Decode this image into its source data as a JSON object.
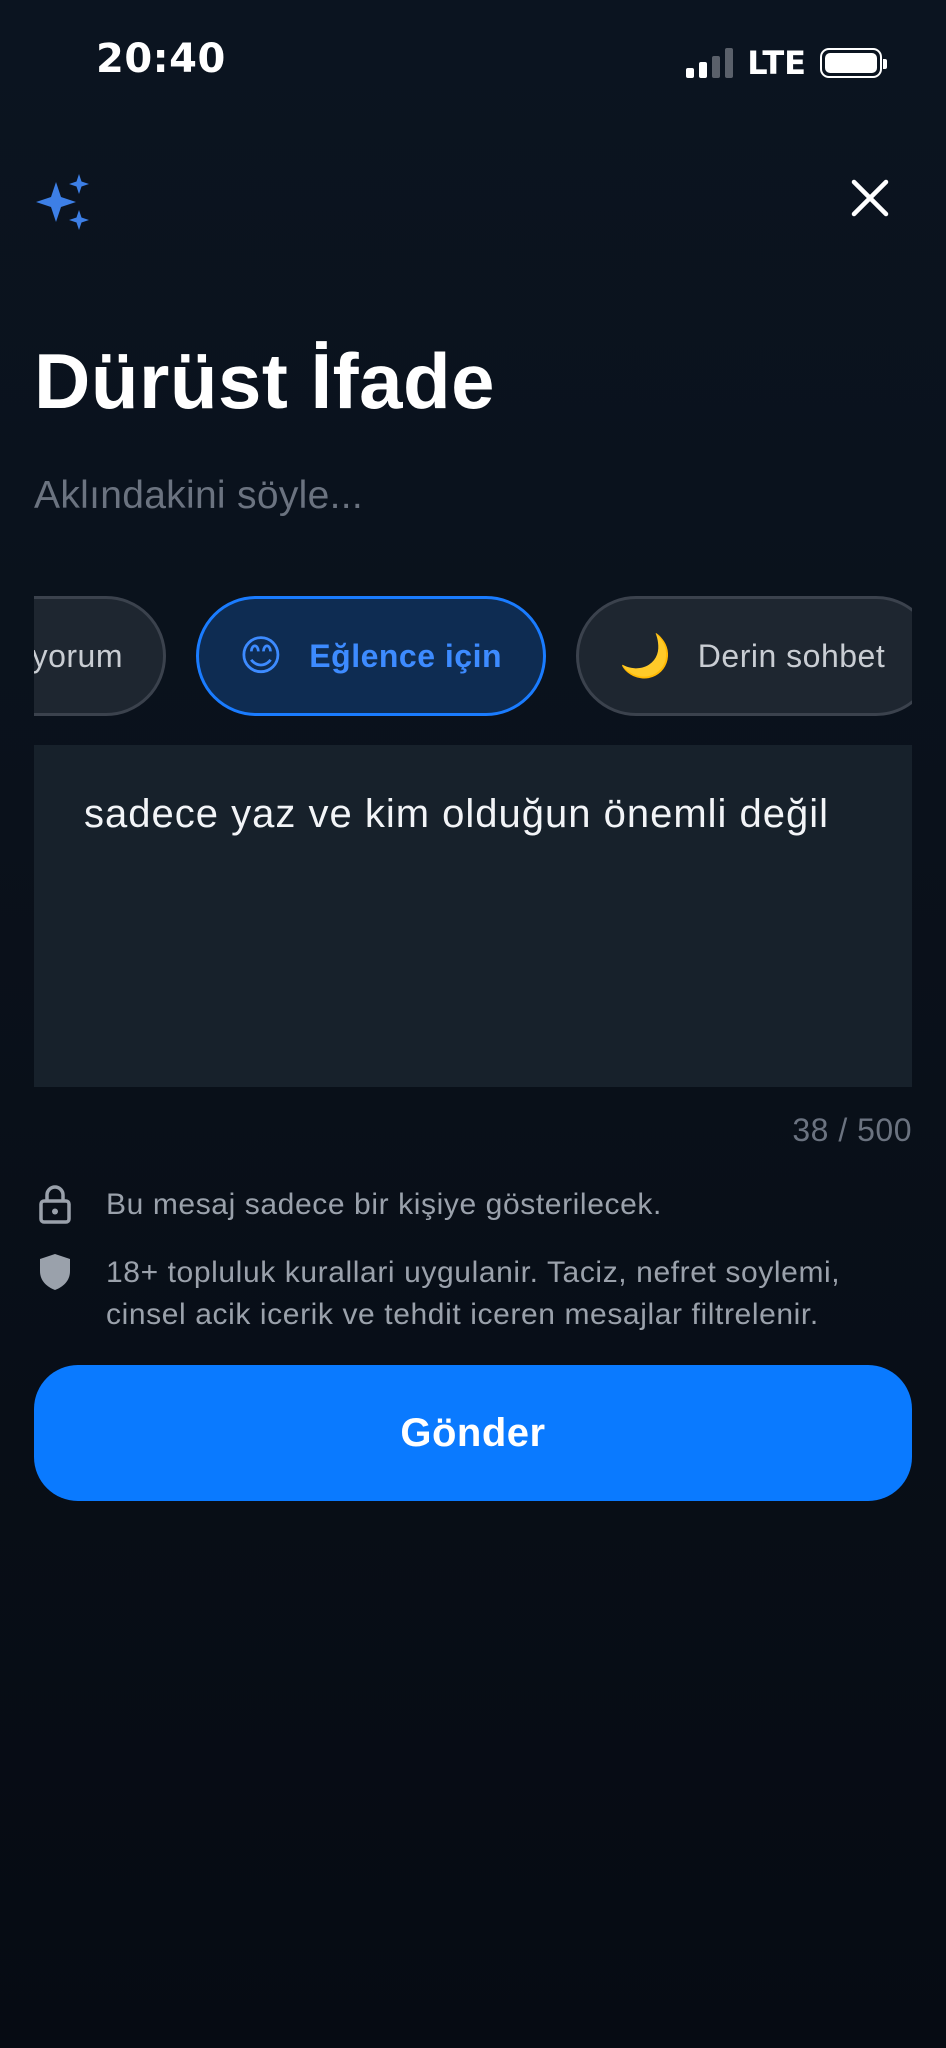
{
  "status_bar": {
    "time": "20:40",
    "network": "LTE"
  },
  "header": {
    "title": "Dürüst İfade",
    "subtitle": "Aklındakini söyle..."
  },
  "chips": [
    {
      "label": "yorum",
      "emoji": "",
      "selected": false
    },
    {
      "label": "Eğlence için",
      "emoji": "😊",
      "selected": true
    },
    {
      "label": "Derin sohbet",
      "emoji": "🌙",
      "selected": false
    }
  ],
  "message": {
    "text": "sadece yaz ve kim olduğun önemli değil",
    "counter": "38 / 500"
  },
  "info": {
    "privacy": "Bu mesaj sadece bir kişiye gösterilecek.",
    "rules": "18+ topluluk kurallari uygulanir. Taciz, nefret soylemi, cinsel acik icerik ve tehdit iceren mesajlar filtrelenir."
  },
  "actions": {
    "send_label": "Gönder"
  },
  "colors": {
    "accent": "#0a7aff",
    "sparkle": "#3d7fe6"
  },
  "icons": {
    "sparkle": "sparkles-icon",
    "close": "close-icon",
    "lock": "lock-icon",
    "shield": "shield-icon"
  }
}
